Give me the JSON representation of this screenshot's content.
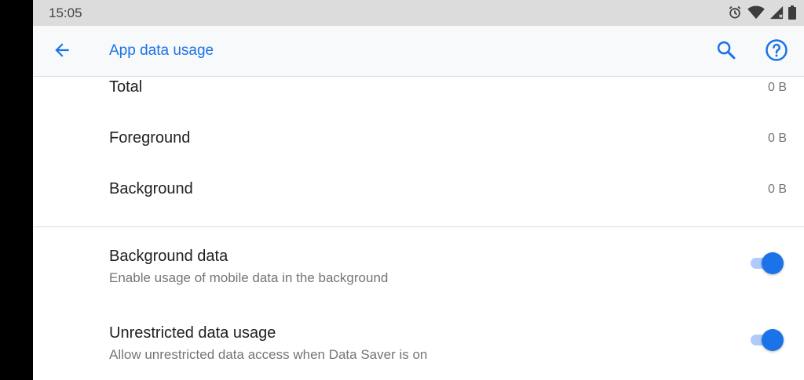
{
  "status_bar": {
    "time": "15:05",
    "icons": [
      "alarm-icon",
      "wifi-icon",
      "cell-signal-icon",
      "battery-icon"
    ]
  },
  "app_bar": {
    "back_icon": "arrow-back-icon",
    "title": "App data usage",
    "search_icon": "search-icon",
    "help_icon": "help-icon"
  },
  "usage": [
    {
      "label": "Total",
      "value": "0 B"
    },
    {
      "label": "Foreground",
      "value": "0 B"
    },
    {
      "label": "Background",
      "value": "0 B"
    }
  ],
  "switches": [
    {
      "title": "Background data",
      "summary": "Enable usage of mobile data in the background",
      "checked": true
    },
    {
      "title": "Unrestricted data usage",
      "summary": "Allow unrestricted data access when Data Saver is on",
      "checked": true
    }
  ],
  "colors": {
    "accent": "#1a73e8",
    "toggle_track": "#aecbfa",
    "status_bar_bg": "#dcdcdc",
    "app_bar_bg": "#f8f9fa"
  }
}
